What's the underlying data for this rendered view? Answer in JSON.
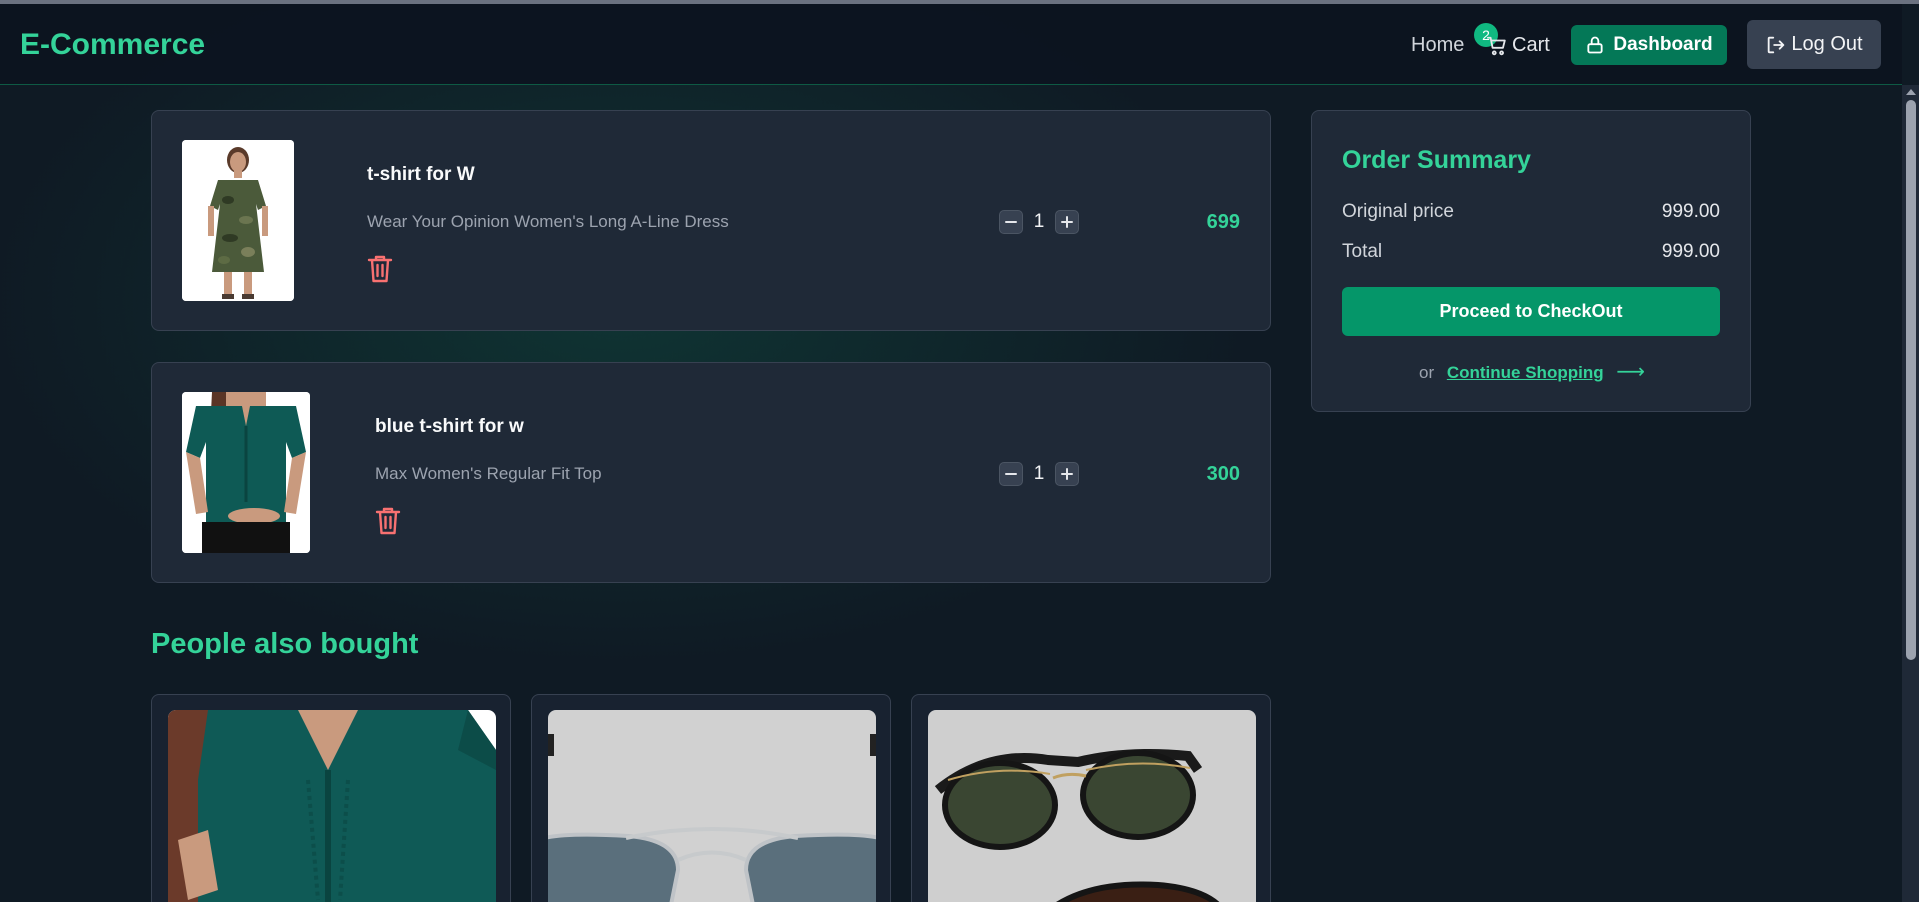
{
  "header": {
    "brand": "E-Commerce",
    "home": "Home",
    "cart_label": "Cart",
    "cart_count": "2",
    "dashboard": "Dashboard",
    "logout": "Log Out"
  },
  "cart": {
    "items": [
      {
        "name": "t-shirt for W",
        "description": "Wear Your Opinion Women's Long A-Line Dress",
        "quantity": "1",
        "price": "699"
      },
      {
        "name": "blue t-shirt for w",
        "description": "Max Women's Regular Fit Top",
        "quantity": "1",
        "price": "300"
      }
    ]
  },
  "summary": {
    "title": "Order Summary",
    "original_label": "Original price",
    "original_value": "999.00",
    "total_label": "Total",
    "total_value": "999.00",
    "checkout": "Proceed to CheckOut",
    "or": "or",
    "continue": "Continue Shopping"
  },
  "recommendations": {
    "title": "People also bought"
  },
  "icons": {
    "cart": "cart-icon",
    "lock": "lock-icon",
    "logout": "logout-icon",
    "trash": "trash-icon",
    "minus": "minus-icon",
    "plus": "plus-icon",
    "arrow": "arrow-right-icon"
  },
  "colors": {
    "accent": "#34d399",
    "button": "#047857",
    "background": "#0f1a24",
    "card": "#1f2937",
    "trash": "#f87171"
  }
}
